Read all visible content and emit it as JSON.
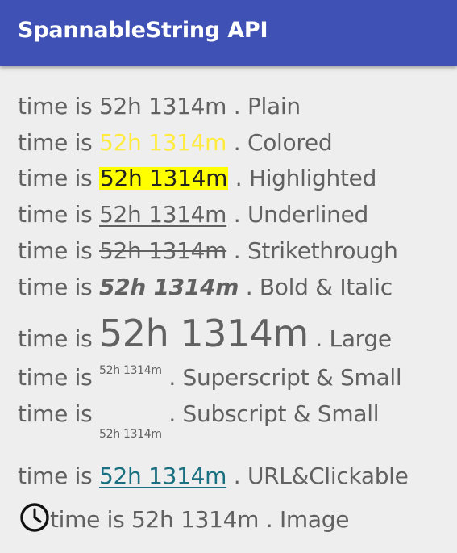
{
  "app_bar": {
    "title": "SpannableString API"
  },
  "colors": {
    "app_bar": "#3f51b5",
    "background": "#eeeeee",
    "text": "#616161",
    "colored_span": "#ffeb3b",
    "highlight": "#ffff00",
    "link": "#1a6f80"
  },
  "rows": [
    {
      "prefix": "time is ",
      "value": "52h 1314m",
      "suffix": " . Plain",
      "style": "plain"
    },
    {
      "prefix": "time is ",
      "value": "52h 1314m",
      "suffix": " . Colored",
      "style": "colored"
    },
    {
      "prefix": "time is ",
      "value": "52h 1314m",
      "suffix": " . Highlighted",
      "style": "highlighted"
    },
    {
      "prefix": "time is ",
      "value": "52h 1314m",
      "suffix": " . Underlined",
      "style": "underlined"
    },
    {
      "prefix": "time is ",
      "value": "52h 1314m",
      "suffix": " . Strikethrough",
      "style": "strikethrough"
    },
    {
      "prefix": "time is ",
      "value": "52h 1314m",
      "suffix": " . Bold & Italic",
      "style": "bold-italic"
    },
    {
      "prefix": "time is ",
      "value": "52h 1314m",
      "suffix": " . Large",
      "style": "large"
    },
    {
      "prefix": "time is ",
      "value": "52h 1314m",
      "suffix": " . Superscript & Small",
      "style": "superscript-small"
    },
    {
      "prefix": "time is ",
      "value": "52h 1314m",
      "suffix": " . Subscript & Small",
      "style": "subscript-small"
    },
    {
      "prefix": "time is ",
      "value": "52h 1314m",
      "suffix": " . URL&Clickable",
      "style": "url-clickable"
    },
    {
      "icon": "clock-icon",
      "text": "time is 52h 1314m . Image",
      "style": "image"
    }
  ]
}
